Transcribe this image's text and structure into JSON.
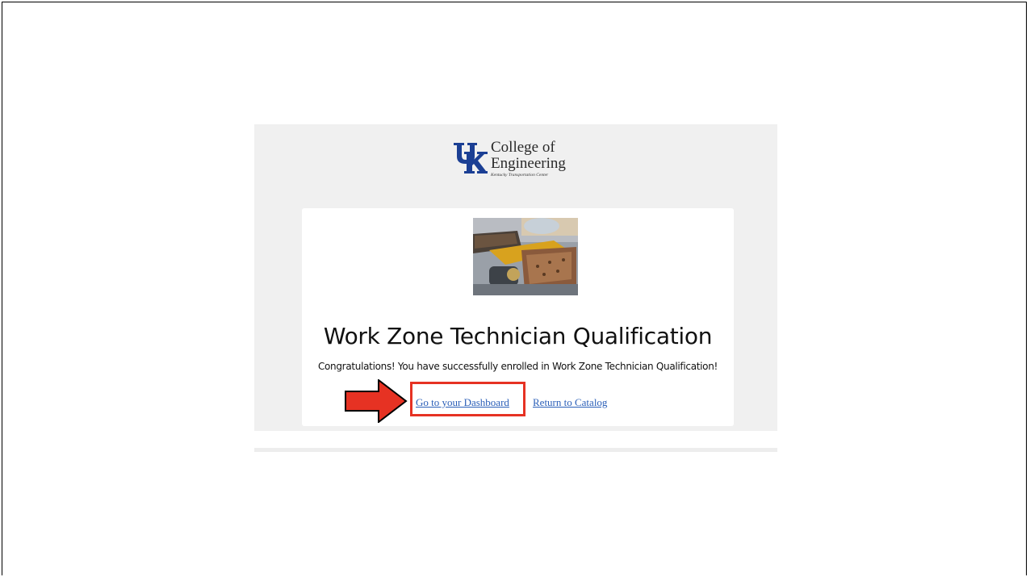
{
  "logo": {
    "line1": "College of",
    "line2": "Engineering",
    "subtitle": "Kentucky Transportation Center",
    "brand_color": "#1b3f94"
  },
  "card": {
    "image_icon": "course-photo",
    "title": "Work Zone Technician Qualification",
    "message": "Congratulations! You have successfully enrolled in Work Zone Technician Qualification!",
    "dashboard_link": "Go to your Dashboard",
    "catalog_link": "Return to Catalog"
  },
  "annotation": {
    "arrow_color": "#e63223",
    "box_color": "#e63223"
  }
}
